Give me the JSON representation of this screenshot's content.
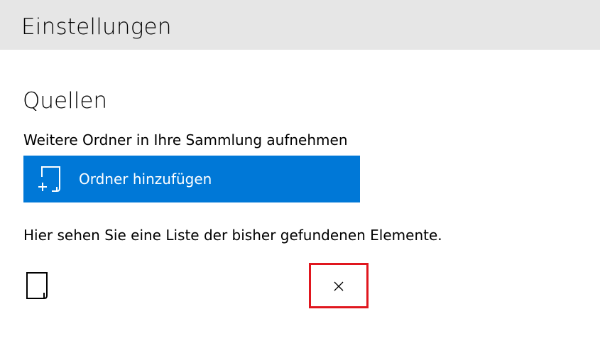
{
  "window": {
    "title": "Einstellungen"
  },
  "sources": {
    "heading": "Quellen",
    "add_description": "Weitere Ordner in Ihre Sammlung aufnehmen",
    "add_button_label": "Ordner hinzufügen",
    "add_button_icon": "add-folder-icon",
    "list_caption": "Hier sehen Sie eine Liste der bisher gefundenen Elemente.",
    "folders": [
      {
        "icon": "folder-icon",
        "name": "",
        "remove_icon": "close-icon"
      }
    ]
  },
  "colors": {
    "titlebar_bg": "#e6e6e6",
    "accent": "#0078d7",
    "highlight_border": "#e0161e"
  }
}
